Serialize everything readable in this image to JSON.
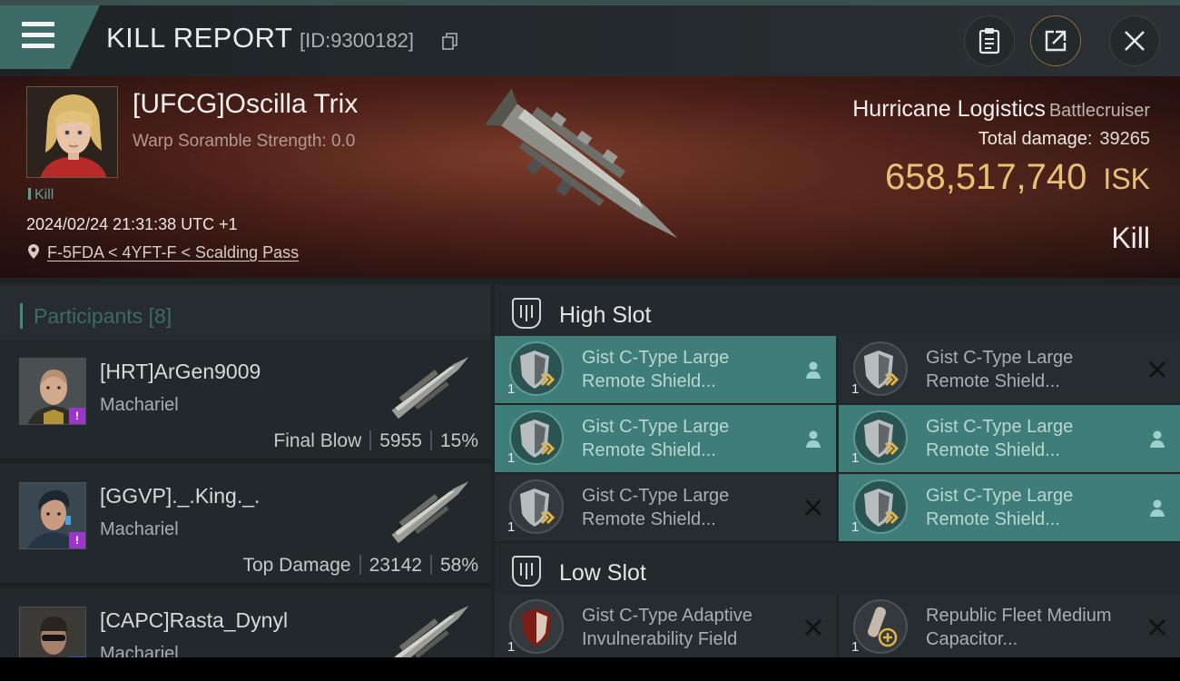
{
  "header": {
    "title": "KILL REPORT",
    "report_id": "[ID:9300182]",
    "icons": {
      "menu": "hamburger-menu-icon",
      "copy": "copy-icon",
      "clipboard": "clipboard-icon",
      "share": "share-icon",
      "close": "close-icon"
    }
  },
  "victim": {
    "name": "[UFCG]Oscilla Trix",
    "warp_scramble": "Warp Soramble Strength: 0.0",
    "tag": "Kill",
    "datetime": "2024/02/24 21:31:38 UTC +1",
    "location": "F-5FDA < 4YFT-F < Scalding Pass",
    "ship_name": "Hurricane Logistics",
    "ship_class": "Battlecruiser",
    "damage_label": "Total damage:",
    "damage_value": "39265",
    "isk_value": "658,517,740",
    "isk_unit": "ISK",
    "result": "Kill"
  },
  "participants": {
    "title": "Participants",
    "count": "[8]",
    "rows": [
      {
        "name": "[HRT]ArGen9009",
        "ship": "Machariel",
        "role": "Final Blow",
        "damage": "5955",
        "percent": "15%",
        "badge_color": "#9b36c8"
      },
      {
        "name": "[GGVP]._.King._.",
        "ship": "Machariel",
        "role": "Top Damage",
        "damage": "23142",
        "percent": "58%",
        "badge_color": "#9b36c8"
      },
      {
        "name": "[CAPC]Rasta_Dynyl",
        "ship": "Machariel",
        "role": "",
        "damage": "",
        "percent": "",
        "badge_color": "#2b57b8"
      }
    ]
  },
  "fitting": {
    "high_slot": {
      "title": "High Slot",
      "modules": [
        {
          "name": "Gist C-Type Large Remote Shield...",
          "qty": "1",
          "active": true,
          "action": "person-icon"
        },
        {
          "name": "Gist C-Type Large Remote Shield...",
          "qty": "1",
          "active": false,
          "action": "close-icon"
        },
        {
          "name": "Gist C-Type Large Remote Shield...",
          "qty": "1",
          "active": true,
          "action": "person-icon"
        },
        {
          "name": "Gist C-Type Large Remote Shield...",
          "qty": "1",
          "active": true,
          "action": "person-icon"
        },
        {
          "name": "Gist C-Type Large Remote Shield...",
          "qty": "1",
          "active": false,
          "action": "close-icon"
        },
        {
          "name": "Gist C-Type Large Remote Shield...",
          "qty": "1",
          "active": true,
          "action": "person-icon"
        }
      ]
    },
    "low_slot": {
      "title": "Low Slot",
      "modules": [
        {
          "name": "Gist C-Type Adaptive Invulnerability Field",
          "qty": "1",
          "active": false,
          "action": "close-icon"
        },
        {
          "name": "Republic Fleet Medium Capacitor...",
          "qty": "1",
          "active": false,
          "action": "close-icon"
        }
      ]
    }
  },
  "colors": {
    "accent": "#3e7d78",
    "isk": "#e8c079",
    "badge_purple": "#9b36c8",
    "badge_blue": "#2b57b8"
  }
}
